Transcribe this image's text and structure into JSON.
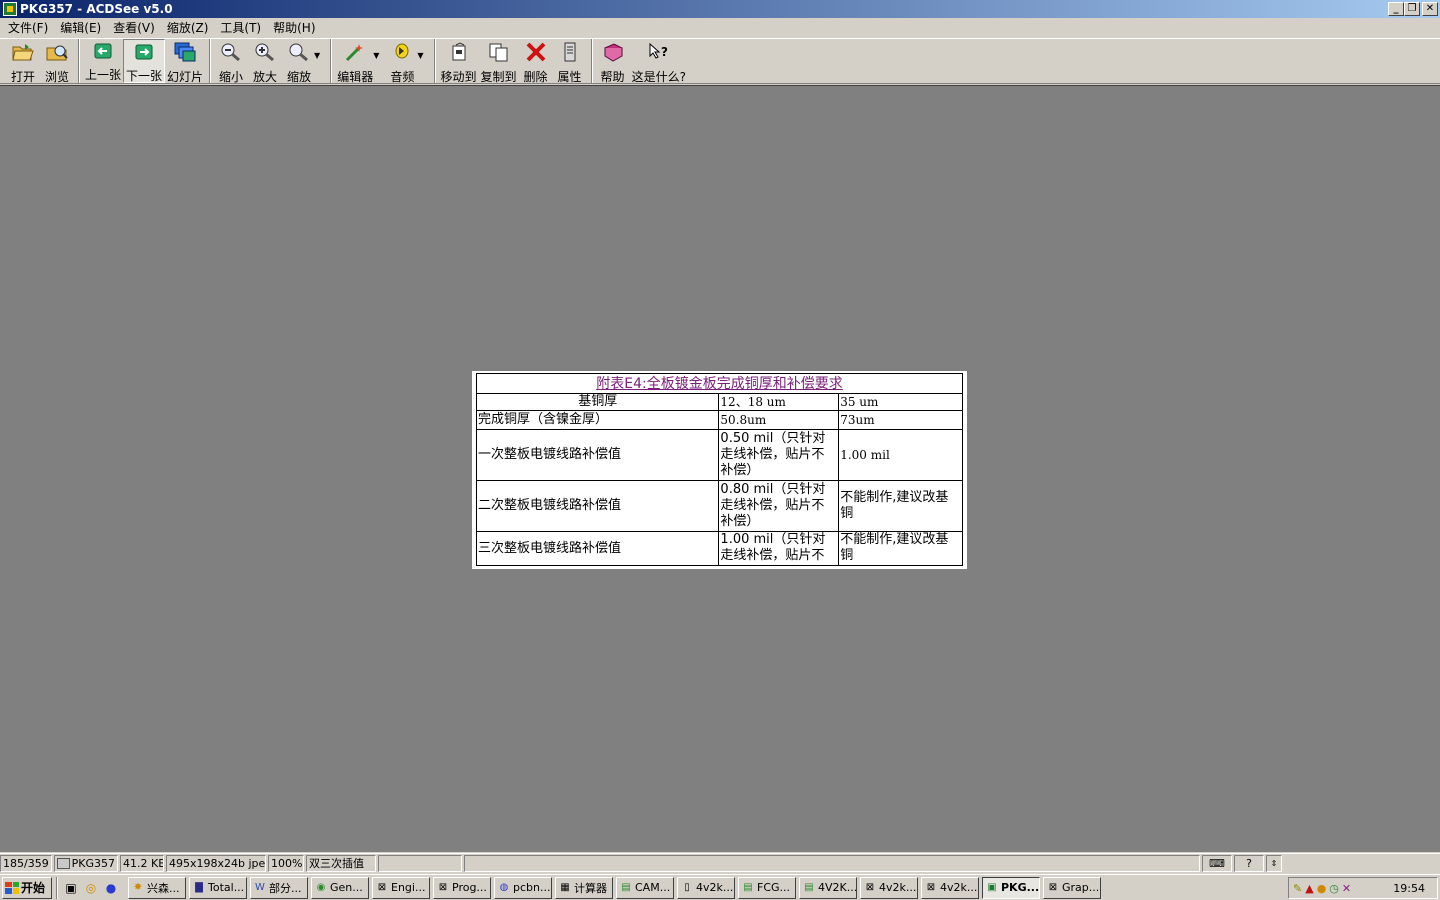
{
  "window": {
    "title": "PKG357 - ACDSee v5.0",
    "controls": [
      "_",
      "❐",
      "✕"
    ]
  },
  "menu": [
    "文件(F)",
    "编辑(E)",
    "查看(V)",
    "缩放(Z)",
    "工具(T)",
    "帮助(H)"
  ],
  "toolbar": {
    "open": "打开",
    "browse": "浏览",
    "prev": "上一张",
    "next": "下一张",
    "slideshow": "幻灯片",
    "zoom_out": "缩小",
    "zoom_in": "放大",
    "zoom": "缩放",
    "editor": "编辑器",
    "audio": "音频",
    "move_to": "移动到",
    "copy_to": "复制到",
    "delete": "删除",
    "properties": "属性",
    "help": "帮助",
    "whats_this": "这是什么?"
  },
  "image": {
    "title": "附表E4:全板镀金板完成铜厚和补偿要求",
    "header": [
      "基铜厚",
      "12、18 um",
      "35 um"
    ],
    "rows": [
      [
        "完成铜厚（含镍金厚）",
        "50.8um",
        "73um"
      ],
      [
        "一次整板电镀线路补偿值",
        "0.50 mil（只针对走线补偿，贴片不补偿）",
        "1.00 mil"
      ],
      [
        "二次整板电镀线路补偿值",
        "0.80 mil（只针对走线补偿，贴片不补偿）",
        "不能制作,建议改基铜"
      ],
      [
        "三次整板电镀线路补偿值",
        "1.00 mil（只针对走线补偿，贴片不",
        "不能制作,建议改基铜"
      ]
    ]
  },
  "status": {
    "index": "185/359",
    "filename": "PKG357",
    "filesize": "41.2 KB",
    "dimensions": "495x198x24b jpeg",
    "zoom": "100%",
    "resample": "双三次插值"
  },
  "taskbar": {
    "start": "开始",
    "tasks": [
      "兴森...",
      "Total...",
      "部分...",
      "Gen...",
      "Engi...",
      "Prog...",
      "pcbn...",
      "计算器",
      "CAM...",
      "4v2k...",
      "FCG...",
      "4V2K...",
      "4v2k...",
      "4v2k...",
      "PKG...",
      "Grap..."
    ],
    "clock": "19:54"
  }
}
